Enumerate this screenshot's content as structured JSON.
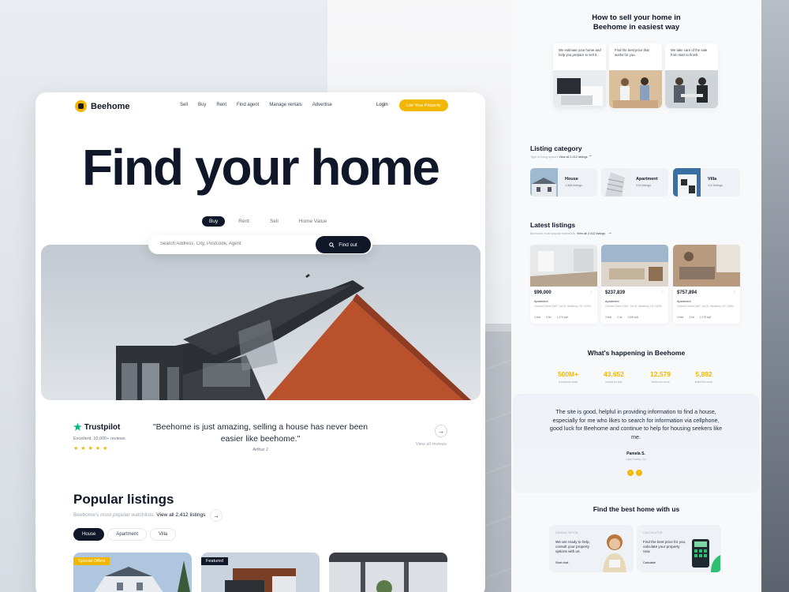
{
  "brand": {
    "name": "Beehome"
  },
  "nav": {
    "links": [
      "Sell",
      "Buy",
      "Rent",
      "Find agent",
      "Manage rentals",
      "Advertise"
    ],
    "login": "Login",
    "cta": "List Your Property"
  },
  "hero": {
    "title": "Find your home",
    "tabs": [
      "Buy",
      "Rent",
      "Sell",
      "Home Value"
    ],
    "active_tab": "Buy",
    "search_placeholder": "Search Address, City, Postcode, Agent",
    "search_button": "Find out"
  },
  "trust": {
    "brand": "Trustpilot",
    "subtitle": "Excellent. 10,000+ reviews",
    "stars": "★★★★★",
    "quote": "\"Beehome is just amazing, selling a house has never been easier like beehome.\"",
    "author": "Arthur J",
    "view_all": "View all reviews"
  },
  "popular": {
    "title": "Popular listings",
    "subtitle": "Beehome's most popular watchlists.",
    "link": "View all 2,412 listings",
    "chips": [
      "House",
      "Apartment",
      "Villa"
    ],
    "active_chip": "House",
    "badges": [
      "Special Offers",
      "Featured"
    ]
  },
  "how": {
    "title_line1": "How to sell your home in",
    "title_line2": "Beehome in easiest way",
    "steps": [
      "We estimate your home and help you prepare to sell it.",
      "Find the best price that works for you.",
      "We take care of the sale from start to finish."
    ]
  },
  "categories": {
    "title": "Listing category",
    "subtitle": "Type of living spaces",
    "link": "View all 2,412 listings",
    "items": [
      {
        "name": "House",
        "count": "1,368 listings"
      },
      {
        "name": "Apartment",
        "count": "913 listings"
      },
      {
        "name": "Villa",
        "count": "112 listings"
      }
    ]
  },
  "latest": {
    "title": "Latest listings",
    "subtitle": "Beehome most popular watchlists.",
    "link": "View all 2,412 listings",
    "items": [
      {
        "price": "$99,000",
        "type": "Apartment",
        "address": "Orchard Street 1567, 1st St, Westbury, NY 11590",
        "beds": "4 bds",
        "baths": "3 ba",
        "area": "1,370 sqft"
      },
      {
        "price": "$237,839",
        "type": "Apartment",
        "address": "Orchard Street 1567, 1st St, Westbury, NY 11590",
        "beds": "3 bds",
        "baths": "2 ba",
        "area": "1105 sqft"
      },
      {
        "price": "$757,894",
        "type": "Apartment",
        "address": "Orchard Street 1567, 1st St, Westbury, NY 11590",
        "beds": "4 bed",
        "baths": "3 ba",
        "area": "1,378 sqft"
      }
    ]
  },
  "stats": {
    "title": "What's happening in Beehome",
    "items": [
      {
        "value": "500M+",
        "label": "in property sales"
      },
      {
        "value": "43,652",
        "label": "homes for sale"
      },
      {
        "value": "12,579",
        "label": "Beehome users"
      },
      {
        "value": "5,892",
        "label": "listed this week"
      }
    ]
  },
  "testimonial": {
    "text": "The site is good, helpful in providing information to find a house, especially for me who likes to search for information via cellphone, good luck for Beehome and continue to help for housing seekers like me.",
    "name": "Pamela S.",
    "location": "Lake Forest, CA"
  },
  "best": {
    "title": "Find the best home with us",
    "cards": [
      {
        "tag": "CONSULTATION",
        "text": "We are ready to help, consult your property options with us.",
        "link": "Start chat"
      },
      {
        "tag": "CALCULATOR",
        "text": "Find the best price for you, calculate your property now.",
        "link": "Calculate"
      }
    ]
  },
  "colors": {
    "accent": "#f2b705",
    "dark": "#0f1729",
    "trustpilot": "#00b67a"
  }
}
